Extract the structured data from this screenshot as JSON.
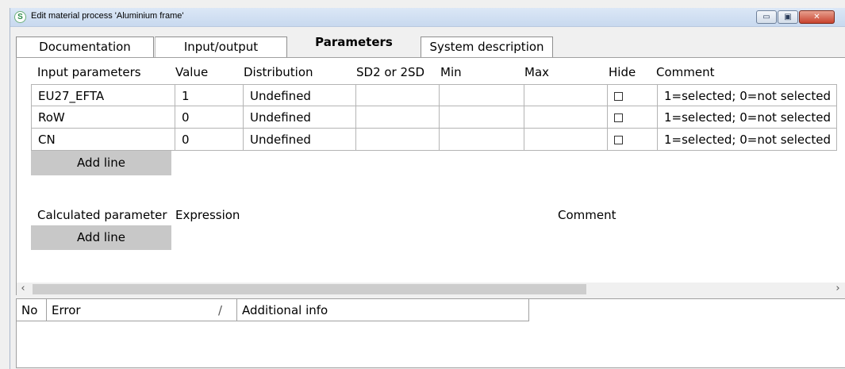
{
  "window": {
    "title": "Edit material process 'Aluminium frame'",
    "app_icon_letter": "S",
    "minimize_glyph": "▭",
    "maximize_glyph": "▣",
    "close_glyph": "✕"
  },
  "tabs": [
    {
      "label": "Documentation",
      "active": false
    },
    {
      "label": "Input/output",
      "active": false
    },
    {
      "label": "Parameters",
      "active": true
    },
    {
      "label": "System description",
      "active": false
    }
  ],
  "input_parameters": {
    "headers": [
      "Input parameters",
      "Value",
      "Distribution",
      "SD2 or 2SD",
      "Min",
      "Max",
      "Hide",
      "Comment"
    ],
    "rows": [
      {
        "name": "EU27_EFTA",
        "value": "1",
        "distribution": "Undefined",
        "sd": "",
        "min": "",
        "max": "",
        "hide": false,
        "comment": "1=selected; 0=not selected"
      },
      {
        "name": "RoW",
        "value": "0",
        "distribution": "Undefined",
        "sd": "",
        "min": "",
        "max": "",
        "hide": false,
        "comment": "1=selected; 0=not selected"
      },
      {
        "name": "CN",
        "value": "0",
        "distribution": "Undefined",
        "sd": "",
        "min": "",
        "max": "",
        "hide": false,
        "comment": "1=selected; 0=not selected"
      }
    ],
    "add_line_label": "Add line"
  },
  "calculated_parameters": {
    "headers": [
      "Calculated parameter",
      "Expression",
      "Comment"
    ],
    "add_line_label": "Add line"
  },
  "scrollbar": {
    "left_arrow": "‹",
    "right_arrow": "›"
  },
  "errors": {
    "headers": [
      "No",
      "Error",
      "Additional info"
    ],
    "sort_glyph": "/"
  }
}
